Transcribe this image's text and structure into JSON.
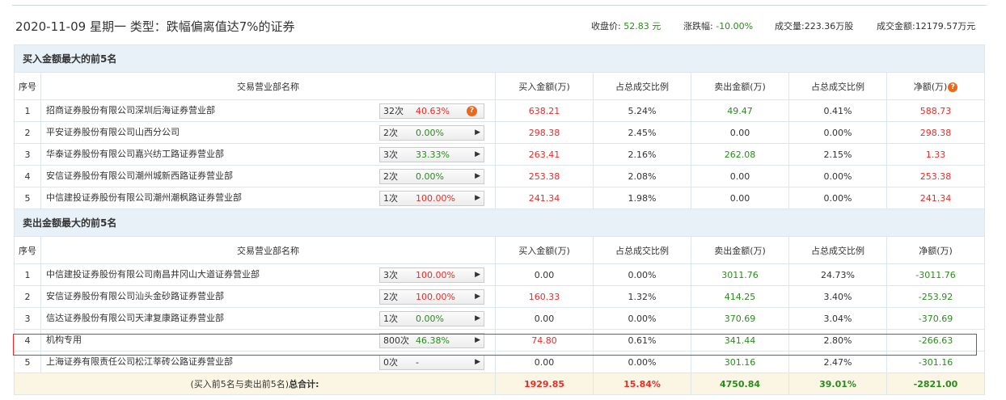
{
  "header": {
    "date_line": "2020-11-09 星期一 类型：跌幅偏离值达7%的证券",
    "close_label": "收盘价:",
    "close_value": "52.83 元",
    "change_label": "涨跌幅:",
    "change_value": "-10.00%",
    "volume_label": "成交量:",
    "volume_value": "223.36万股",
    "amount_label": "成交金额:",
    "amount_value": "12179.57万元"
  },
  "columns": {
    "seq": "序号",
    "name": "交易营业部名称",
    "buy": "买入金额(万)",
    "buy_ratio": "占总成交比例",
    "sell": "卖出金额(万)",
    "sell_ratio": "占总成交比例",
    "net": "净额(万)"
  },
  "buy_section": {
    "title": "买入金额最大的前5名",
    "rows": [
      {
        "seq": "1",
        "name": "招商证券股份有限公司深圳后海证券营业部",
        "times": "32次",
        "rate": "40.63%",
        "rate_color": "red",
        "buy": "638.21",
        "buy_ratio": "5.24%",
        "sell": "49.47",
        "sell_ratio": "0.41%",
        "net": "588.73",
        "net_color": "red",
        "icon": "question-icon"
      },
      {
        "seq": "2",
        "name": "平安证券股份有限公司山西分公司",
        "times": "2次",
        "rate": "0.00%",
        "rate_color": "green",
        "buy": "298.38",
        "buy_ratio": "2.45%",
        "sell": "0.00",
        "sell_ratio": "0.00%",
        "net": "298.38",
        "net_color": "red",
        "icon": "arrow-right-icon"
      },
      {
        "seq": "3",
        "name": "华泰证券股份有限公司嘉兴纺工路证券营业部",
        "times": "3次",
        "rate": "33.33%",
        "rate_color": "green",
        "buy": "263.41",
        "buy_ratio": "2.16%",
        "sell": "262.08",
        "sell_ratio": "2.15%",
        "net": "1.33",
        "net_color": "red",
        "icon": "arrow-right-icon"
      },
      {
        "seq": "4",
        "name": "安信证券股份有限公司潮州城新西路证券营业部",
        "times": "2次",
        "rate": "0.00%",
        "rate_color": "green",
        "buy": "253.38",
        "buy_ratio": "2.08%",
        "sell": "0.00",
        "sell_ratio": "0.00%",
        "net": "253.38",
        "net_color": "red",
        "icon": "arrow-right-icon"
      },
      {
        "seq": "5",
        "name": "中信建投证券股份有限公司潮州潮枫路证券营业部",
        "times": "1次",
        "rate": "100.00%",
        "rate_color": "red",
        "buy": "241.34",
        "buy_ratio": "1.98%",
        "sell": "0.00",
        "sell_ratio": "0.00%",
        "net": "241.34",
        "net_color": "red",
        "icon": "arrow-right-icon"
      }
    ]
  },
  "sell_section": {
    "title": "卖出金额最大的前5名",
    "rows": [
      {
        "seq": "1",
        "name": "中信建投证券股份有限公司南昌井冈山大道证券营业部",
        "times": "3次",
        "rate": "100.00%",
        "rate_color": "red",
        "buy": "0.00",
        "buy_ratio": "0.00%",
        "sell": "3011.76",
        "sell_ratio": "24.73%",
        "net": "-3011.76",
        "net_color": "green",
        "icon": "arrow-right-icon"
      },
      {
        "seq": "2",
        "name": "安信证券股份有限公司汕头金砂路证券营业部",
        "times": "2次",
        "rate": "100.00%",
        "rate_color": "red",
        "buy": "160.33",
        "buy_ratio": "1.32%",
        "sell": "414.25",
        "sell_ratio": "3.40%",
        "net": "-253.92",
        "net_color": "green",
        "icon": "arrow-right-icon"
      },
      {
        "seq": "3",
        "name": "信达证券股份有限公司天津复康路证券营业部",
        "times": "1次",
        "rate": "0.00%",
        "rate_color": "green",
        "buy": "0.00",
        "buy_ratio": "0.00%",
        "sell": "370.69",
        "sell_ratio": "3.04%",
        "net": "-370.69",
        "net_color": "green",
        "icon": "arrow-right-icon"
      },
      {
        "seq": "4",
        "name": "机构专用",
        "times": "800次",
        "rate": "46.38%",
        "rate_color": "green",
        "buy": "74.80",
        "buy_ratio": "0.61%",
        "sell": "341.44",
        "sell_ratio": "2.80%",
        "net": "-266.63",
        "net_color": "green",
        "icon": "arrow-right-icon"
      },
      {
        "seq": "5",
        "name": "上海证券有限责任公司松江莘砖公路证券营业部",
        "times": "0次",
        "rate": "-",
        "rate_color": "black",
        "buy": "0.00",
        "buy_ratio": "0.00%",
        "sell": "301.16",
        "sell_ratio": "2.47%",
        "net": "-301.16",
        "net_color": "green",
        "icon": "arrow-right-icon"
      }
    ]
  },
  "total": {
    "label_prefix": "(买入前5名与卖出前5名)",
    "label_bold": "总合计:",
    "buy": "1929.85",
    "buy_ratio": "15.84%",
    "sell": "4750.84",
    "sell_ratio": "39.01%",
    "net": "-2821.00"
  },
  "colors": {
    "red": "#e0302b",
    "green": "#2b8a1e",
    "section_bg": "#e8f1f8",
    "total_bg": "#fbf6e4"
  }
}
